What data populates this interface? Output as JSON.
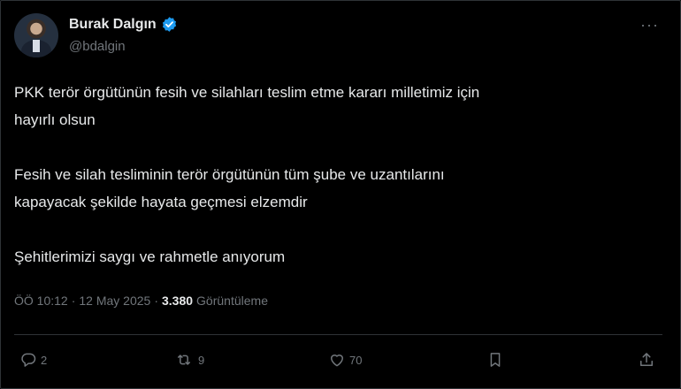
{
  "tweet": {
    "author_name": "Burak Dalgın",
    "author_handle": "@bdalgin",
    "text_lines": [
      "PKK terör örgütünün fesih ve silahları teslim etme kararı milletimiz için",
      "hayırlı olsun",
      "Fesih ve silah tesliminin terör örgütünün tüm şube ve uzantılarını",
      "kapayacak şekilde hayata geçmesi elzemdir",
      "Şehitlerimizi saygı ve rahmetle anıyorum"
    ],
    "meta": {
      "time": "ÖÖ 10:12",
      "separator1": "·",
      "date": "12 May 2025",
      "separator2": "·",
      "views_count": "3.380",
      "views_label": "Görüntüleme"
    },
    "actions": {
      "reply_count": "2",
      "retweet_count": "9",
      "like_count": "70"
    }
  },
  "icons": {
    "avatar": "avatar",
    "verified": "verified-badge-icon",
    "more": "more-icon",
    "reply": "reply-icon",
    "retweet": "retweet-icon",
    "like": "heart-icon",
    "bookmark": "bookmark-icon",
    "share": "share-icon"
  },
  "colors": {
    "background": "#000000",
    "text_primary": "#e7e9ea",
    "text_secondary": "#71767b",
    "verified_blue": "#1d9bf0",
    "border": "#2f3336"
  }
}
